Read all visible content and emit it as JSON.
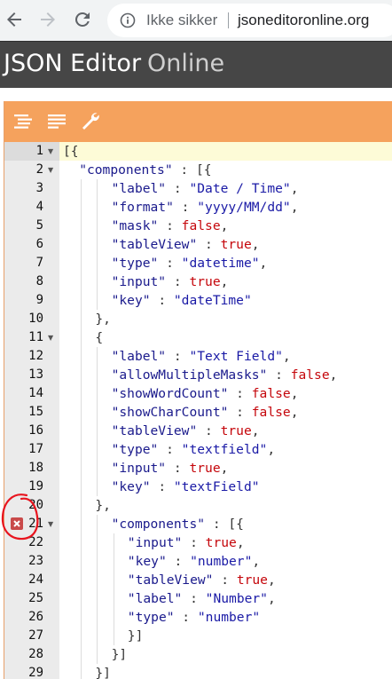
{
  "browser": {
    "not_secure_label": "Ikke sikker",
    "url": "jsoneditoronline.org"
  },
  "app": {
    "title_main": "JSON Editor",
    "title_sub": "Online"
  },
  "toolbar": {
    "buttons": [
      "format-icon",
      "compact-icon",
      "repair-icon"
    ]
  },
  "editor": {
    "error_line": 21,
    "lines": [
      {
        "n": "1",
        "fold": true,
        "indent": 0,
        "tokens": [
          [
            "punc",
            "[{"
          ]
        ]
      },
      {
        "n": "2",
        "fold": true,
        "indent": 1,
        "tokens": [
          [
            "key",
            "\"components\""
          ],
          [
            "punc",
            " : [{"
          ]
        ]
      },
      {
        "n": "3",
        "indent": 3,
        "tokens": [
          [
            "key",
            "\"label\""
          ],
          [
            "punc",
            " : "
          ],
          [
            "str",
            "\"Date / Time\""
          ],
          [
            "punc",
            ","
          ]
        ]
      },
      {
        "n": "4",
        "indent": 3,
        "tokens": [
          [
            "key",
            "\"format\""
          ],
          [
            "punc",
            " : "
          ],
          [
            "str",
            "\"yyyy/MM/dd\""
          ],
          [
            "punc",
            ","
          ]
        ]
      },
      {
        "n": "5",
        "indent": 3,
        "tokens": [
          [
            "key",
            "\"mask\""
          ],
          [
            "punc",
            " : "
          ],
          [
            "bool",
            "false"
          ],
          [
            "punc",
            ","
          ]
        ]
      },
      {
        "n": "6",
        "indent": 3,
        "tokens": [
          [
            "key",
            "\"tableView\""
          ],
          [
            "punc",
            " : "
          ],
          [
            "bool",
            "true"
          ],
          [
            "punc",
            ","
          ]
        ]
      },
      {
        "n": "7",
        "indent": 3,
        "tokens": [
          [
            "key",
            "\"type\""
          ],
          [
            "punc",
            " : "
          ],
          [
            "str",
            "\"datetime\""
          ],
          [
            "punc",
            ","
          ]
        ]
      },
      {
        "n": "8",
        "indent": 3,
        "tokens": [
          [
            "key",
            "\"input\""
          ],
          [
            "punc",
            " : "
          ],
          [
            "bool",
            "true"
          ],
          [
            "punc",
            ","
          ]
        ]
      },
      {
        "n": "9",
        "indent": 3,
        "tokens": [
          [
            "key",
            "\"key\""
          ],
          [
            "punc",
            " : "
          ],
          [
            "str",
            "\"dateTime\""
          ]
        ]
      },
      {
        "n": "10",
        "indent": 2,
        "tokens": [
          [
            "punc",
            "},"
          ]
        ]
      },
      {
        "n": "11",
        "fold": true,
        "indent": 2,
        "tokens": [
          [
            "punc",
            "{"
          ]
        ]
      },
      {
        "n": "12",
        "indent": 3,
        "tokens": [
          [
            "key",
            "\"label\""
          ],
          [
            "punc",
            " : "
          ],
          [
            "str",
            "\"Text Field\""
          ],
          [
            "punc",
            ","
          ]
        ]
      },
      {
        "n": "13",
        "indent": 3,
        "tokens": [
          [
            "key",
            "\"allowMultipleMasks\""
          ],
          [
            "punc",
            " : "
          ],
          [
            "bool",
            "false"
          ],
          [
            "punc",
            ","
          ]
        ]
      },
      {
        "n": "14",
        "indent": 3,
        "tokens": [
          [
            "key",
            "\"showWordCount\""
          ],
          [
            "punc",
            " : "
          ],
          [
            "bool",
            "false"
          ],
          [
            "punc",
            ","
          ]
        ]
      },
      {
        "n": "15",
        "indent": 3,
        "tokens": [
          [
            "key",
            "\"showCharCount\""
          ],
          [
            "punc",
            " : "
          ],
          [
            "bool",
            "false"
          ],
          [
            "punc",
            ","
          ]
        ]
      },
      {
        "n": "16",
        "indent": 3,
        "tokens": [
          [
            "key",
            "\"tableView\""
          ],
          [
            "punc",
            " : "
          ],
          [
            "bool",
            "true"
          ],
          [
            "punc",
            ","
          ]
        ]
      },
      {
        "n": "17",
        "indent": 3,
        "tokens": [
          [
            "key",
            "\"type\""
          ],
          [
            "punc",
            " : "
          ],
          [
            "str",
            "\"textfield\""
          ],
          [
            "punc",
            ","
          ]
        ]
      },
      {
        "n": "18",
        "indent": 3,
        "tokens": [
          [
            "key",
            "\"input\""
          ],
          [
            "punc",
            " : "
          ],
          [
            "bool",
            "true"
          ],
          [
            "punc",
            ","
          ]
        ]
      },
      {
        "n": "19",
        "indent": 3,
        "tokens": [
          [
            "key",
            "\"key\""
          ],
          [
            "punc",
            " : "
          ],
          [
            "str",
            "\"textField\""
          ]
        ]
      },
      {
        "n": "20",
        "indent": 2,
        "tokens": [
          [
            "punc",
            "},"
          ]
        ]
      },
      {
        "n": "21",
        "fold": true,
        "error": true,
        "indent": 3,
        "tokens": [
          [
            "key",
            "\"components\""
          ],
          [
            "punc",
            " : [{"
          ]
        ]
      },
      {
        "n": "22",
        "indent": 4,
        "tokens": [
          [
            "key",
            "\"input\""
          ],
          [
            "punc",
            " : "
          ],
          [
            "bool",
            "true"
          ],
          [
            "punc",
            ","
          ]
        ]
      },
      {
        "n": "23",
        "indent": 4,
        "tokens": [
          [
            "key",
            "\"key\""
          ],
          [
            "punc",
            " : "
          ],
          [
            "str",
            "\"number\""
          ],
          [
            "punc",
            ","
          ]
        ]
      },
      {
        "n": "24",
        "indent": 4,
        "tokens": [
          [
            "key",
            "\"tableView\""
          ],
          [
            "punc",
            " : "
          ],
          [
            "bool",
            "true"
          ],
          [
            "punc",
            ","
          ]
        ]
      },
      {
        "n": "25",
        "indent": 4,
        "tokens": [
          [
            "key",
            "\"label\""
          ],
          [
            "punc",
            " : "
          ],
          [
            "str",
            "\"Number\""
          ],
          [
            "punc",
            ","
          ]
        ]
      },
      {
        "n": "26",
        "indent": 4,
        "tokens": [
          [
            "key",
            "\"type\""
          ],
          [
            "punc",
            " : "
          ],
          [
            "str",
            "\"number\""
          ]
        ]
      },
      {
        "n": "27",
        "indent": 4,
        "tokens": [
          [
            "punc",
            "}]"
          ]
        ]
      },
      {
        "n": "28",
        "indent": 3,
        "tokens": [
          [
            "punc",
            "}]"
          ]
        ]
      },
      {
        "n": "29",
        "indent": 2,
        "tokens": [
          [
            "punc",
            "}]"
          ]
        ]
      }
    ]
  },
  "colors": {
    "menubar": "#f5a25d",
    "header": "#464646",
    "gutter": "#ebebeb",
    "active_line": "#fdfbd7",
    "error": "#c94a4a",
    "annotation": "#e8141e"
  }
}
